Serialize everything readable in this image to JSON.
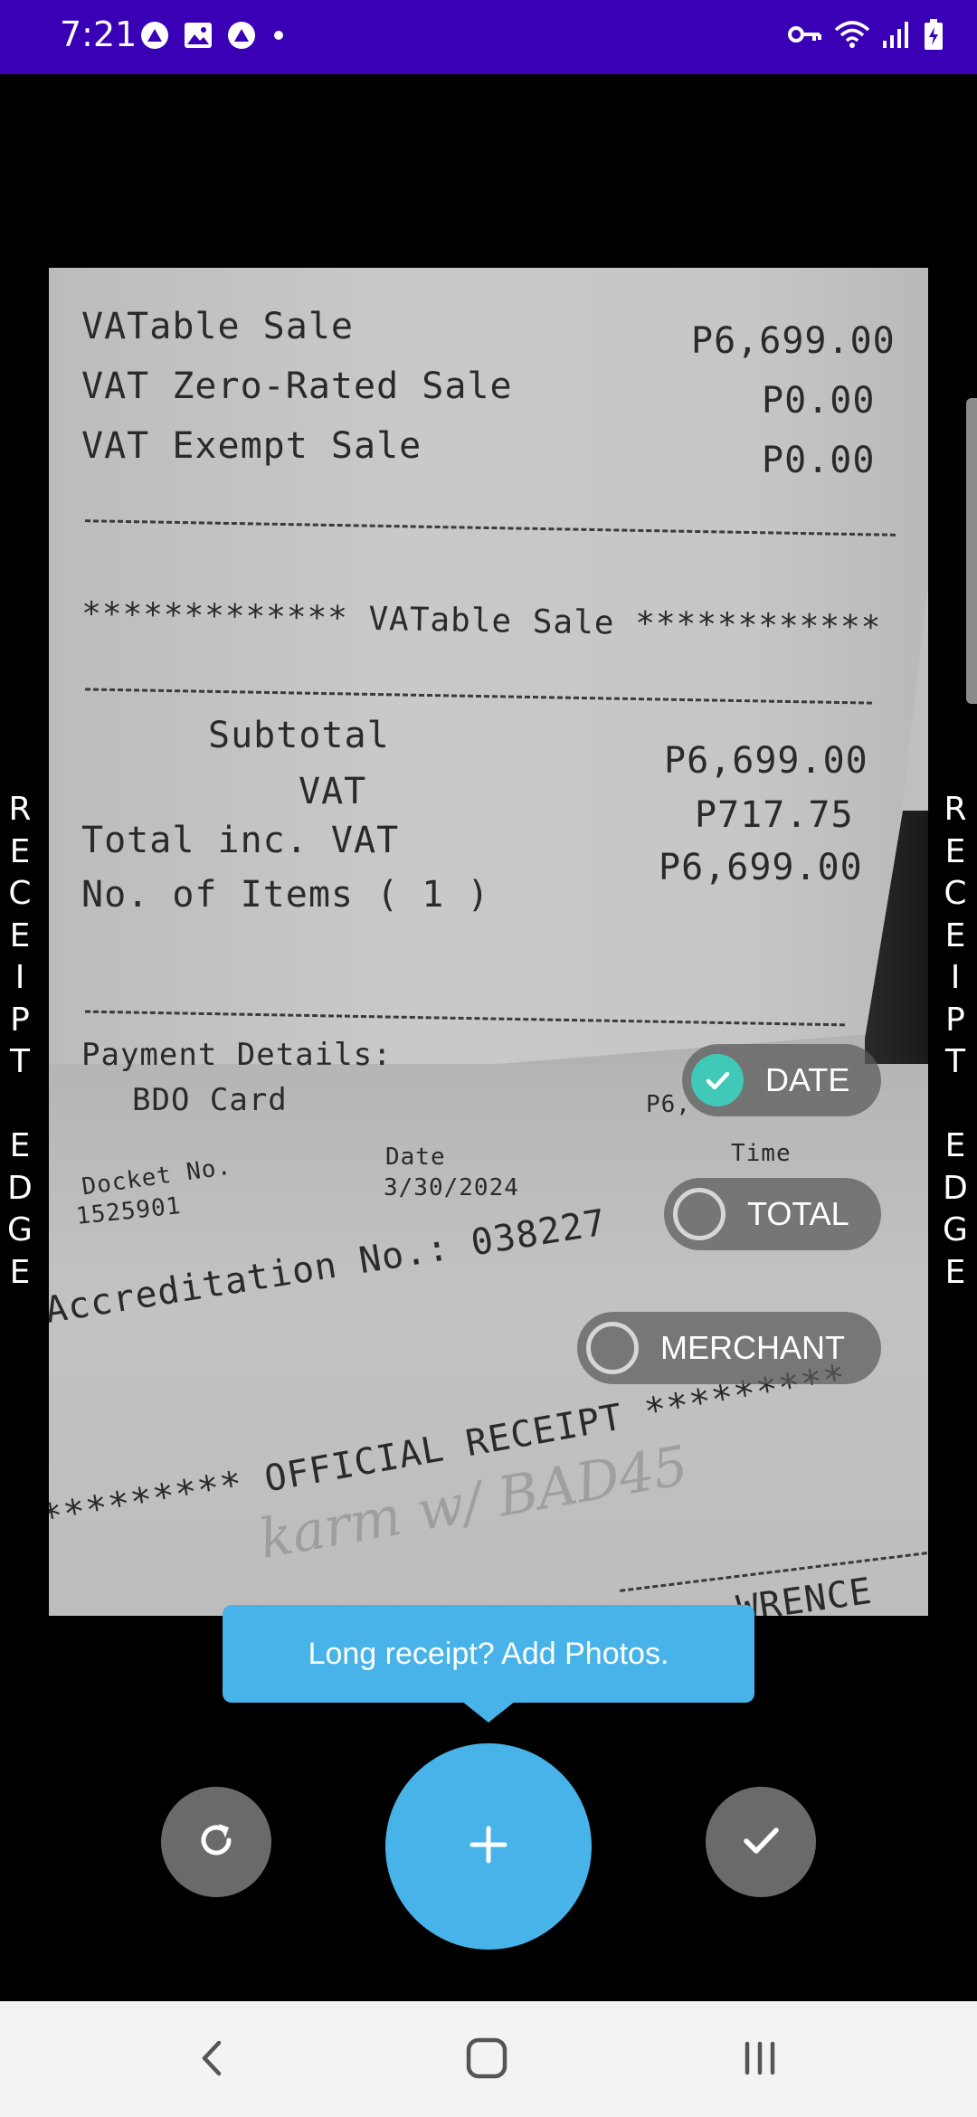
{
  "status_bar": {
    "time": "7:21",
    "background": "#3a00b6",
    "left_icons": [
      "app-notification-icon",
      "gallery-icon",
      "app-notification-icon",
      "dot-icon"
    ],
    "right_icons": [
      "vpn-key-icon",
      "wifi-icon",
      "signal-icon",
      "battery-charging-icon"
    ]
  },
  "receipt_photo": {
    "lines": [
      {
        "label": "VATable Sale",
        "value": "P6,699.00"
      },
      {
        "label": "VAT Zero-Rated Sale",
        "value": "P0.00"
      },
      {
        "label": "VAT Exempt Sale",
        "value": "P0.00"
      }
    ],
    "section_heading": "************* VATable Sale ************",
    "summary": [
      {
        "label": "Subtotal",
        "value": "P6,699.00"
      },
      {
        "label": "VAT",
        "value": "P717.75"
      },
      {
        "label": "Total inc. VAT",
        "value": "P6,699.00"
      },
      {
        "label": "No. of Items ( 1 )",
        "value": ""
      }
    ],
    "payment_details": "Payment Details:",
    "payment_method": "BDO Card",
    "payment_amount_partial": "P6,",
    "docket_label": "Docket No.",
    "docket_number": "1525901",
    "date_label": "Date",
    "date_value": "3/30/2024",
    "time_label": "Time",
    "accreditation": "Accreditation No.: 038227",
    "official_receipt": "*********  OFFICIAL RECEIPT  *********",
    "handwriting": "karm w/ BAD45",
    "bottom_text": "WRENCE"
  },
  "edge_labels": {
    "left": "R\nE\nC\nE\nI\nP\nT\n \nE\nD\nG\nE",
    "right": "R\nE\nC\nE\nI\nP\nT\n \nE\nD\nG\nE"
  },
  "fields": {
    "date": {
      "label": "DATE",
      "checked": true
    },
    "total": {
      "label": "TOTAL",
      "checked": false
    },
    "merchant": {
      "label": "MERCHANT",
      "checked": false
    }
  },
  "tooltip": {
    "text": "Long receipt? Add Photos."
  },
  "actions": {
    "retake_icon": "refresh-icon",
    "add_icon": "plus-icon",
    "done_icon": "check-icon",
    "accent": "#48b3e8",
    "check_color": "#3fc9b6"
  },
  "nav_bar": {
    "icons": [
      "back-icon",
      "home-icon",
      "recents-icon"
    ]
  }
}
